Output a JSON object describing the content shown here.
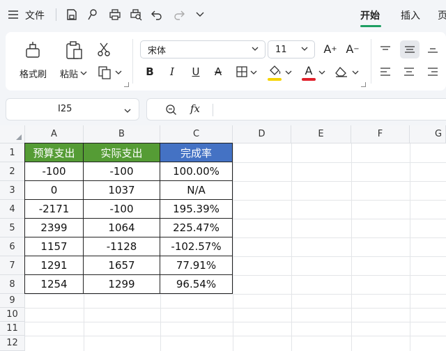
{
  "menubar": {
    "file_label": "文件",
    "tabs": [
      {
        "label": "开始",
        "active": true
      },
      {
        "label": "插入",
        "active": false
      }
    ],
    "accent_color": "#1e9e63"
  },
  "ribbon": {
    "format_painter_label": "格式刷",
    "paste_label": "粘贴",
    "font_name": "宋体",
    "font_size": "11",
    "bold_label": "B",
    "italic_label": "I",
    "underline_label": "U",
    "strike_label": "A",
    "font_color_label": "A",
    "grow_label": "A",
    "shrink_label": "A",
    "highlight_color": "#f6d400",
    "font_color": "#e0202a"
  },
  "formula_bar": {
    "name_box": "I25",
    "fx_label": "fx",
    "formula": ""
  },
  "sheet": {
    "columns": [
      "A",
      "B",
      "C",
      "D",
      "E",
      "F",
      "G"
    ],
    "rows": [
      "1",
      "2",
      "3",
      "4",
      "5",
      "6",
      "7",
      "8",
      "9",
      "10",
      "11",
      "12"
    ],
    "headers": [
      "预算支出",
      "实际支出",
      "完成率"
    ],
    "header_colors": [
      "#559c35",
      "#559c35",
      "#4472c4"
    ],
    "data": [
      [
        "-100",
        "-100",
        "100.00%"
      ],
      [
        "0",
        "1037",
        "N/A"
      ],
      [
        "-2171",
        "-100",
        "195.39%"
      ],
      [
        "2399",
        "1064",
        "225.47%"
      ],
      [
        "1157",
        "-1128",
        "-102.57%"
      ],
      [
        "1291",
        "1657",
        "77.91%"
      ],
      [
        "1254",
        "1299",
        "96.54%"
      ]
    ]
  }
}
